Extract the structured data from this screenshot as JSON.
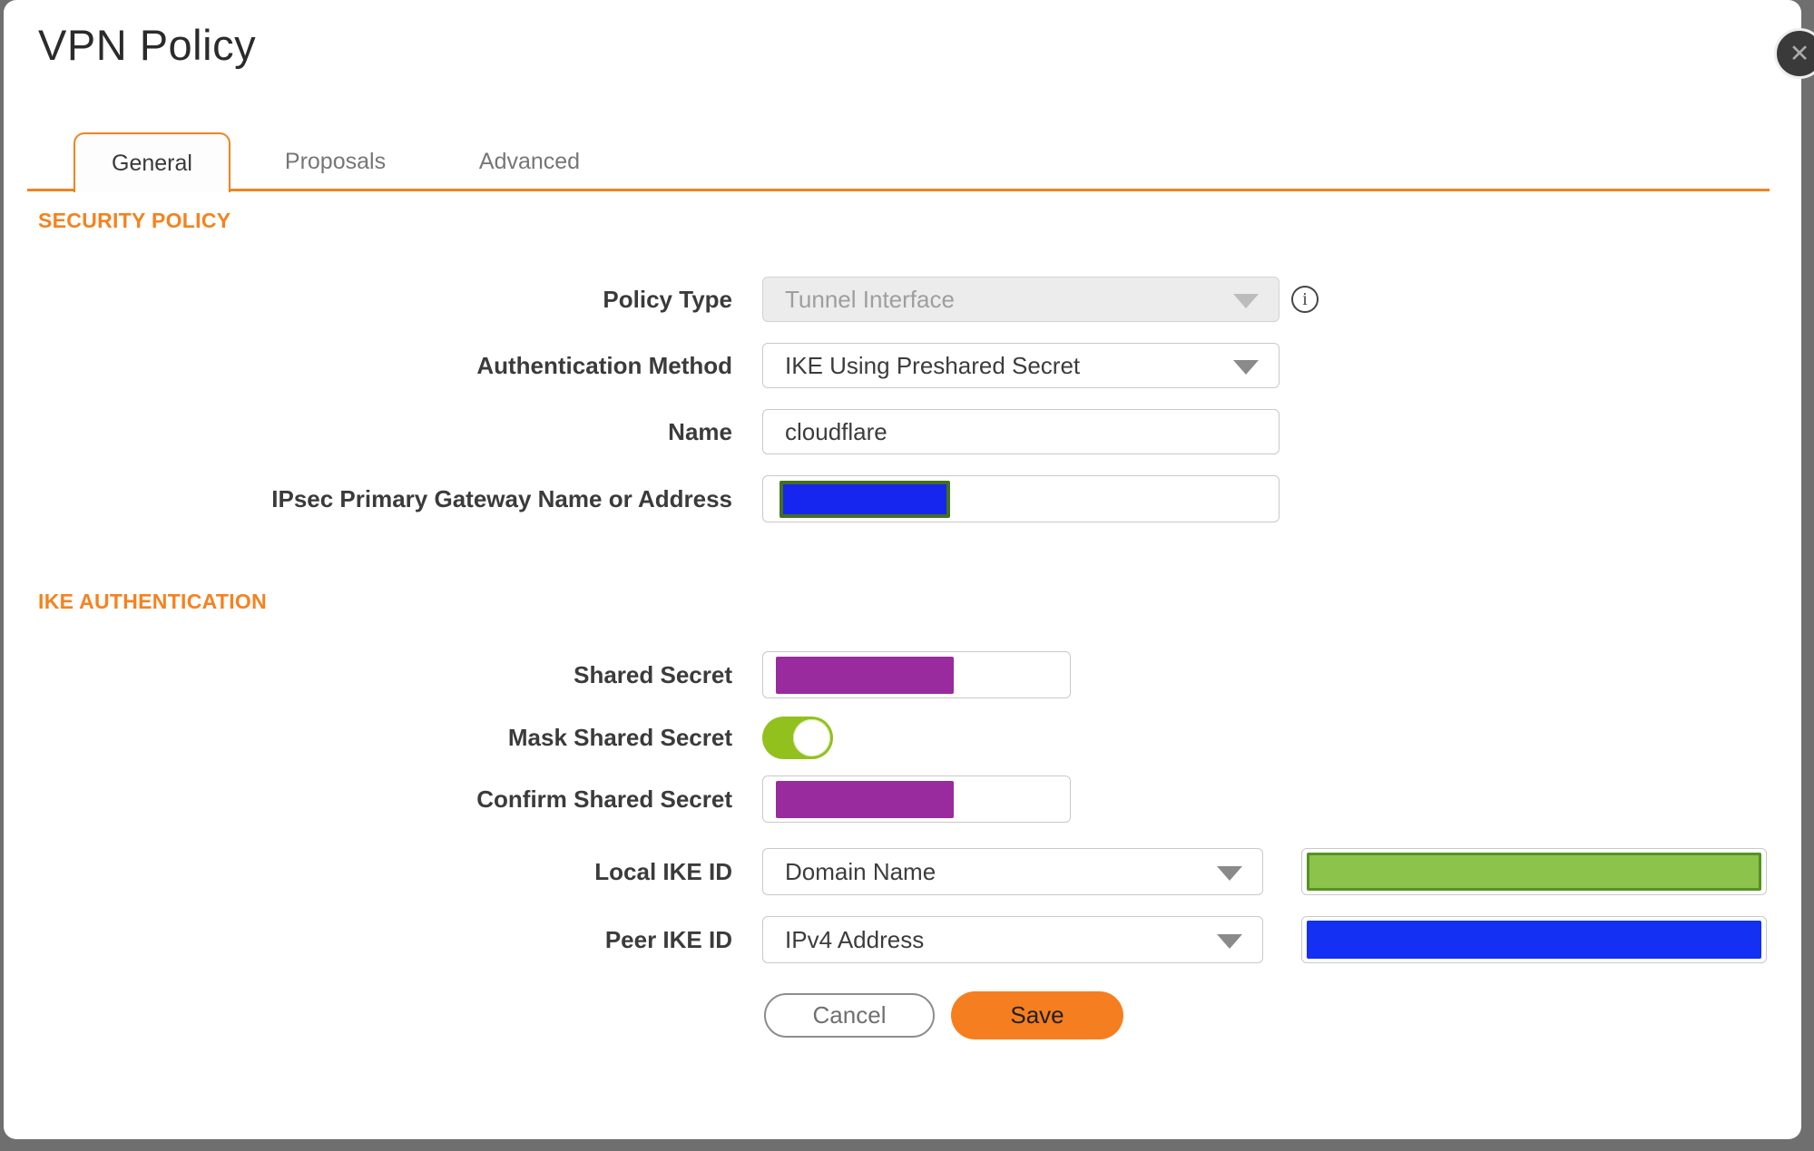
{
  "dialog": {
    "title": "VPN Policy",
    "close_glyph": "✕"
  },
  "tabs": [
    {
      "label": "General",
      "active": true
    },
    {
      "label": "Proposals",
      "active": false
    },
    {
      "label": "Advanced",
      "active": false
    }
  ],
  "sections": {
    "security_policy": {
      "heading": "SECURITY POLICY"
    },
    "ike_authentication": {
      "heading": "IKE AUTHENTICATION"
    }
  },
  "fields": {
    "policy_type": {
      "label": "Policy Type",
      "value": "Tunnel Interface",
      "disabled": true
    },
    "authentication_method": {
      "label": "Authentication Method",
      "value": "IKE Using Preshared Secret"
    },
    "name": {
      "label": "Name",
      "value": "cloudflare"
    },
    "ipsec_gateway": {
      "label": "IPsec Primary Gateway Name or Address",
      "value_state": "redacted"
    },
    "shared_secret": {
      "label": "Shared Secret",
      "value_state": "redacted"
    },
    "mask_shared_secret": {
      "label": "Mask Shared Secret",
      "state": "on"
    },
    "confirm_shared_secret": {
      "label": "Confirm Shared Secret",
      "value_state": "redacted"
    },
    "local_ike_id": {
      "label": "Local IKE ID",
      "type_value": "Domain Name",
      "value_state": "redacted"
    },
    "peer_ike_id": {
      "label": "Peer IKE ID",
      "type_value": "IPv4 Address",
      "value_state": "redacted"
    }
  },
  "buttons": {
    "cancel": "Cancel",
    "save": "Save"
  },
  "icons": {
    "info": "i"
  },
  "colors": {
    "accent_orange": "#f5821f",
    "toggle_green": "#92c11e",
    "redact_purple": "#992b9e",
    "redact_blue": "#1726ef",
    "redact_green": "#8cc34b",
    "redact_olive_border": "#42701f",
    "backdrop_gray": "#6f6f6f"
  }
}
